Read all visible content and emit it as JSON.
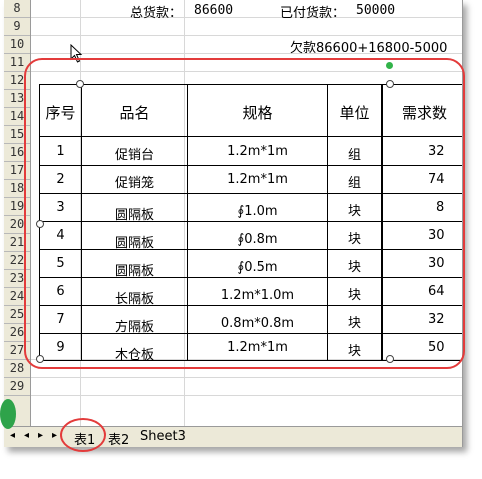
{
  "rows": [
    "8",
    "9",
    "10",
    "11",
    "12",
    "13",
    "14",
    "15",
    "16",
    "17",
    "18",
    "19",
    "20",
    "21",
    "22",
    "23",
    "24",
    "25",
    "26",
    "27",
    "28",
    "29"
  ],
  "top_text": {
    "total_label": "总货款：",
    "total_value": "86600",
    "paid_label": "已付货款：",
    "paid_value": "50000",
    "owed": "欠款86600+16800-5000"
  },
  "table": {
    "headers": [
      "序号",
      "品名",
      "规格",
      "单位",
      "需求数"
    ],
    "rows": [
      [
        "1",
        "促销台",
        "1.2m*1m",
        "组",
        "32"
      ],
      [
        "2",
        "促销笼",
        "1.2m*1m",
        "组",
        "74"
      ],
      [
        "3",
        "圆隔板",
        "∮1.0m",
        "块",
        "8"
      ],
      [
        "4",
        "圆隔板",
        "∮0.8m",
        "块",
        "30"
      ],
      [
        "5",
        "圆隔板",
        "∮0.5m",
        "块",
        "30"
      ],
      [
        "6",
        "长隔板",
        "1.2m*1.0m",
        "块",
        "64"
      ],
      [
        "7",
        "方隔板",
        "0.8m*0.8m",
        "块",
        "32"
      ],
      [
        "9",
        "木仓板",
        "1.2m*1m",
        "块",
        "50"
      ]
    ]
  },
  "tabs": {
    "tab1": "表1",
    "tab2": "表2",
    "tab3": "Sheet3"
  },
  "colors": {
    "highlight": "#e33b3b",
    "rotate_handle": "#32b34a"
  }
}
